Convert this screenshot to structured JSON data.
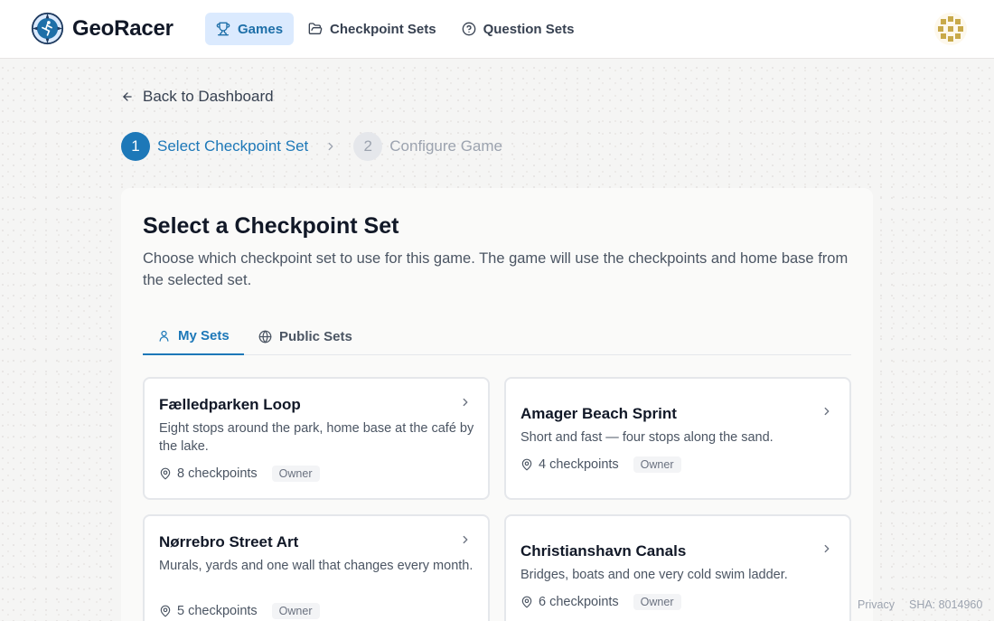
{
  "brand": {
    "name": "GeoRacer",
    "logo_icon": "compass-runner-icon"
  },
  "nav": {
    "items": [
      {
        "label": "Games",
        "icon": "trophy-icon",
        "active": true
      },
      {
        "label": "Checkpoint Sets",
        "icon": "folder-icon",
        "active": false
      },
      {
        "label": "Question Sets",
        "icon": "help-circle-icon",
        "active": false
      }
    ]
  },
  "back_link": {
    "label": "Back to Dashboard",
    "icon": "arrow-left-icon"
  },
  "stepper": {
    "steps": [
      {
        "number": "1",
        "label": "Select Checkpoint Set",
        "state": "active"
      },
      {
        "number": "2",
        "label": "Configure Game",
        "state": "inactive"
      }
    ]
  },
  "panel": {
    "title": "Select a Checkpoint Set",
    "description": "Choose which checkpoint set to use for this game. The game will use the checkpoints and home base from the selected set."
  },
  "tabs": [
    {
      "label": "My Sets",
      "icon": "user-icon",
      "active": true
    },
    {
      "label": "Public Sets",
      "icon": "globe-icon",
      "active": false
    }
  ],
  "sets": [
    {
      "name": "Fælledparken Loop",
      "description": "Eight stops around the park, home base at the café by the lake.",
      "count": "8 checkpoints",
      "badge": "Owner"
    },
    {
      "name": "Amager Beach Sprint",
      "description": "Short and fast — four stops along the sand.",
      "count": "4 checkpoints",
      "badge": "Owner"
    },
    {
      "name": "Nørrebro Street Art",
      "description": "Murals, yards and one wall that changes every month.",
      "count": "5 checkpoints",
      "badge": "Owner"
    },
    {
      "name": "Christianshavn Canals",
      "description": "Bridges, boats and one very cold swim ladder.",
      "count": "6 checkpoints",
      "badge": "Owner"
    }
  ],
  "footer": {
    "privacy": "Privacy",
    "sha": "SHA: 8014960"
  },
  "colors": {
    "accent": "#1d78b8",
    "nav_active_bg": "#dbeafe",
    "avatar": "#c8a94a"
  }
}
